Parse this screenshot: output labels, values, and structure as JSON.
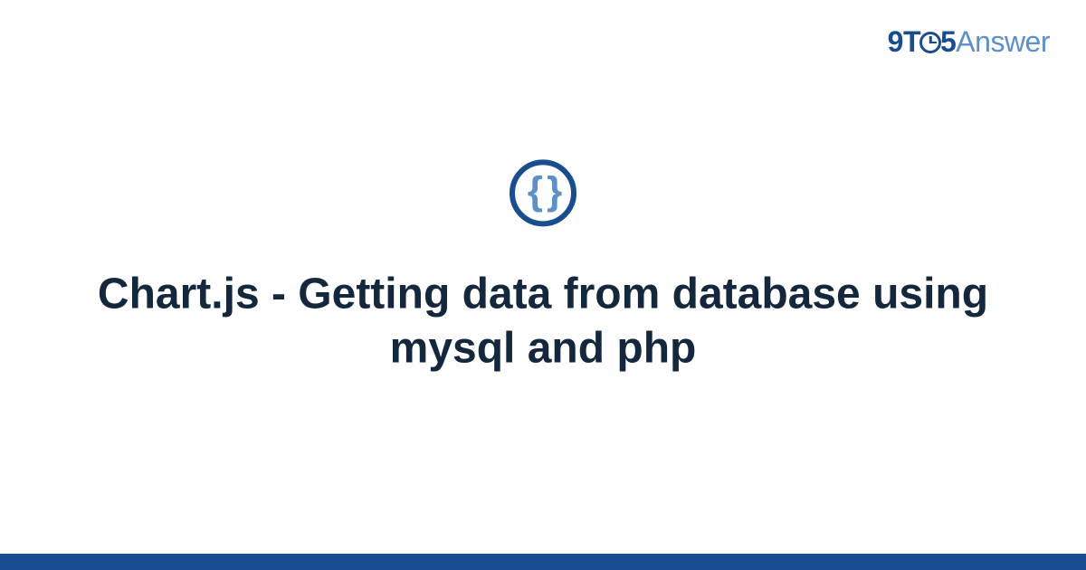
{
  "logo": {
    "nine": "9",
    "t": "T",
    "five": "5",
    "answer": "Answer"
  },
  "icon": {
    "name": "code-braces-icon",
    "glyph": "{ }"
  },
  "title": "Chart.js - Getting data from database using mysql and php",
  "colors": {
    "primary": "#1a4d8f",
    "secondary": "#5d8fc9",
    "text": "#14273d"
  }
}
